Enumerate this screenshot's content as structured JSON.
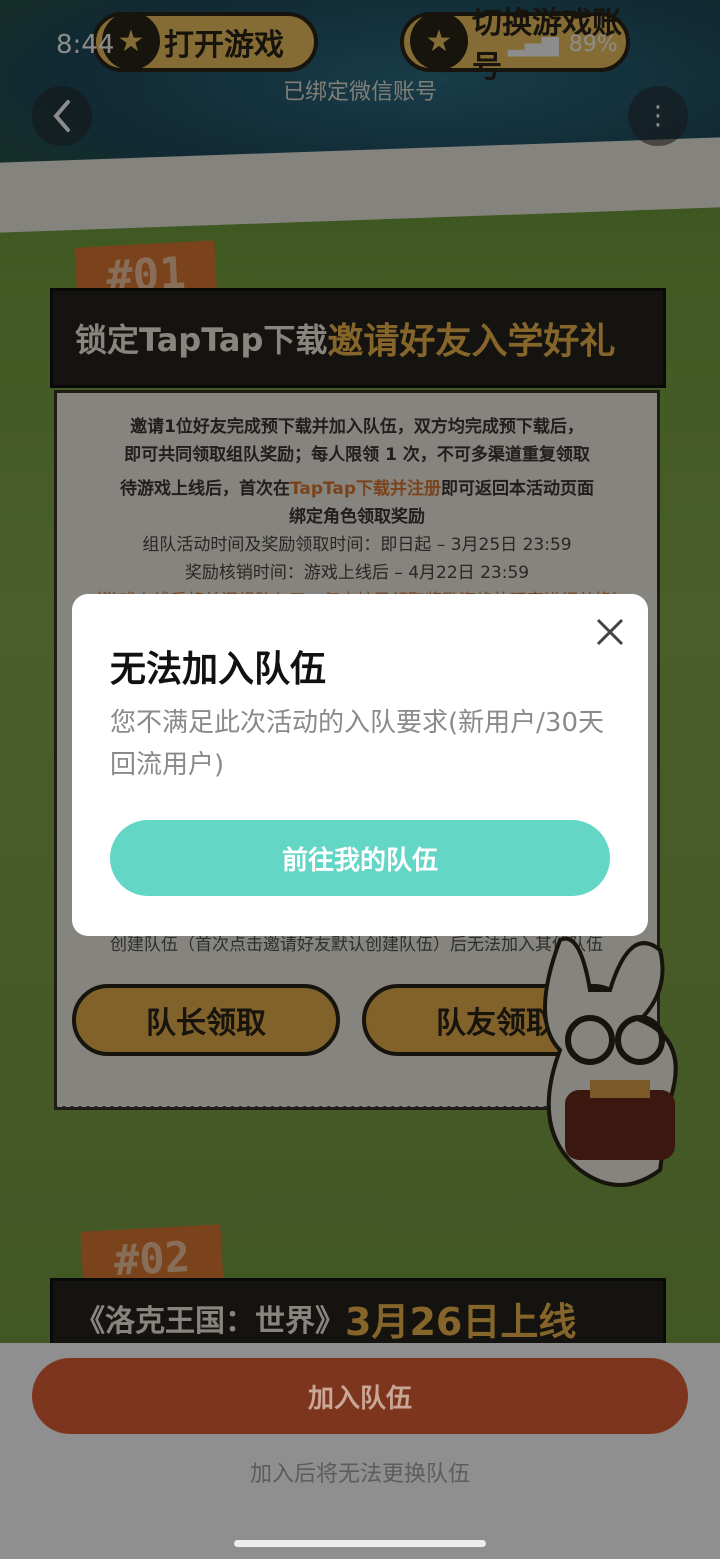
{
  "status_bar": {
    "time": "8:44",
    "battery": "89%",
    "signal": "5G"
  },
  "header": {
    "open_game_label": "打开游戏",
    "switch_label": "切换游戏账号",
    "bound_text": "已绑定微信账号"
  },
  "section1": {
    "tag": "#01",
    "banner_prefix": "锁定TapTap下载",
    "banner_highlight": "邀请好友入学好礼",
    "line1": "邀请1位好友完成预下载并加入队伍，双方均完成预下载后，",
    "line2": "即可共同领取组队奖励；每人限领 1 次，不可多渠道重复领取",
    "line3_a": "待游戏上线后，首次在",
    "line3_b": "TapTap下载并注册",
    "line3_c": "即可返回本活动页面",
    "line4": "绑定角色领取奖励",
    "line5": "组队活动时间及奖励领取时间：即日起 – 3月25日 23:59",
    "line6": "奖励核销时间：游戏上线后 – 4月22日 23:59",
    "line7": "（游戏上线后将关闭组队入口，仅支持已领取奖励资格的玩家进行兑换）",
    "creation_note": "创建队伍（首次点击邀请好友默认创建队伍）后无法加入其他队伍",
    "leader_claim": "队长领取",
    "member_claim": "队友领取"
  },
  "section2": {
    "tag": "#02",
    "banner_prefix": "《洛克王国：世界》",
    "banner_highlight": "3月26日上线"
  },
  "dialog": {
    "title": "无法加入队伍",
    "message": "您不满足此次活动的入队要求(新用户/30天回流用户)",
    "button": "前往我的队伍"
  },
  "bottom": {
    "join_button": "加入队伍",
    "note": "加入后将无法更换队伍"
  }
}
